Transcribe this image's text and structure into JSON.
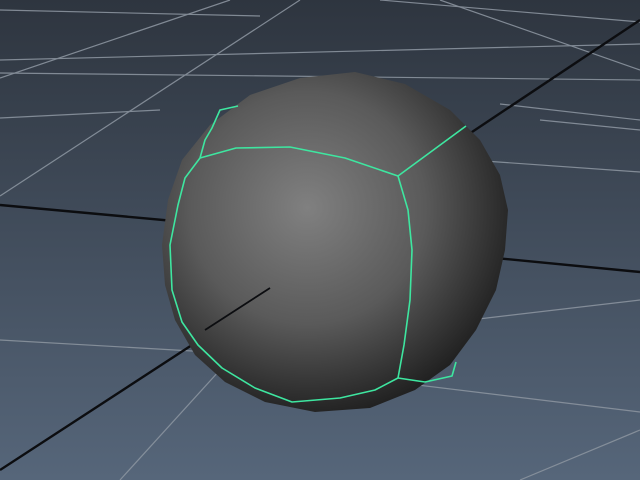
{
  "viewport": {
    "background_top": "#2e353f",
    "background_bottom": "#56667a",
    "grid_color": "#8a939e",
    "axis_color": "#0c0d10"
  },
  "object": {
    "shape": "sphere",
    "selected": true,
    "shade_light": "#808080",
    "shade_dark": "#202020",
    "selection_color": "#3ee6a0"
  }
}
